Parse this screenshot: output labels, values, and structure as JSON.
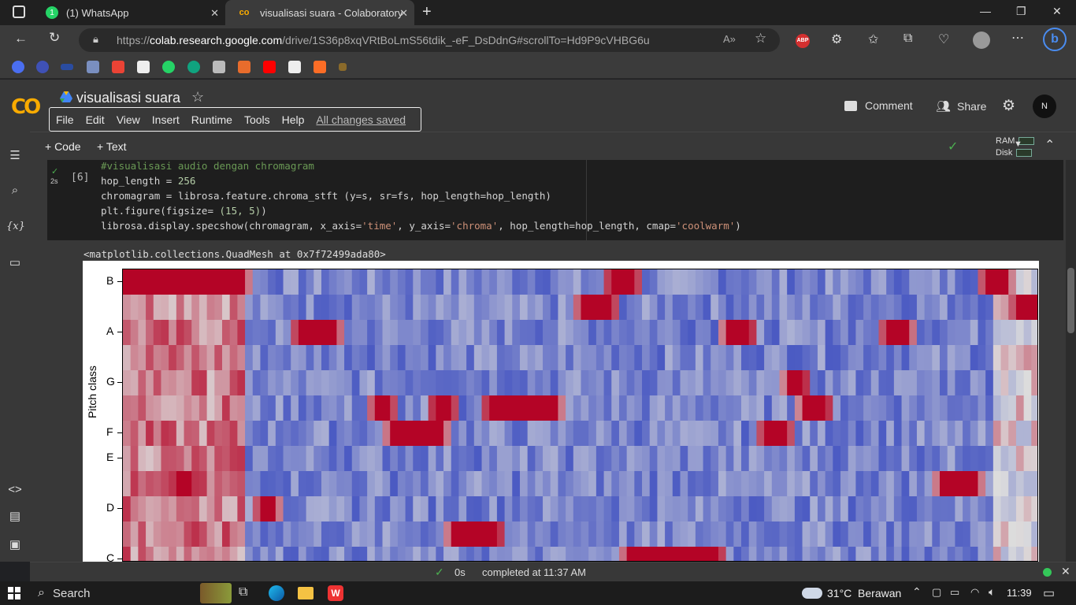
{
  "browser": {
    "tabs": [
      {
        "title": "(1) WhatsApp",
        "icon": "whatsapp-icon"
      },
      {
        "title": "visualisasi suara - Colaboratory",
        "icon": "colab-icon",
        "active": true
      }
    ],
    "url_prefix": "https://",
    "url_host": "colab.research.google.com",
    "url_path": "/drive/1S36p8xqVRtBoLmS56tdik_-eF_DsDdnG#scrollTo=Hd9P9cVHBG6u",
    "abp_label": "ABP"
  },
  "colab": {
    "logo": "CO",
    "title": "visualisasi suara",
    "menus": [
      "File",
      "Edit",
      "View",
      "Insert",
      "Runtime",
      "Tools",
      "Help"
    ],
    "saved_status": "All changes saved",
    "comment_label": "Comment",
    "share_label": "Share",
    "avatar_initials": "N",
    "toolbar": {
      "code_label": "+ Code",
      "text_label": "+ Text",
      "ram_label": "RAM",
      "disk_label": "Disk"
    }
  },
  "cell": {
    "exec_count": "[6]",
    "runtime": "2s",
    "code": {
      "line1": "#visualisasi audio dengan chromagram",
      "line2_a": "hop_length = ",
      "line2_b": "256",
      "line3": "chromagram = librosa.feature.chroma_stft (y=s, sr=fs, hop_length=hop_length)",
      "line4_a": "plt.figure(figsize= ",
      "line4_b": "(15, 5)",
      "line4_c": ")",
      "line5_a": "librosa.display.specshow(chromagram, x_axis=",
      "line5_b": "'time'",
      "line5_c": ", y_axis=",
      "line5_d": "'chroma'",
      "line5_e": ", hop_length=hop_length, cmap=",
      "line5_f": "'coolwarm'",
      "line5_g": ")"
    },
    "output_text": "<matplotlib.collections.QuadMesh at 0x7f72499ada80>"
  },
  "chart_data": {
    "type": "heatmap",
    "ylabel": "Pitch class",
    "y_ticks": [
      "B",
      "A",
      "G",
      "F",
      "E",
      "D",
      "C"
    ],
    "colormap": "coolwarm",
    "rows_top_to_bottom": [
      "B",
      "A#",
      "A",
      "G#",
      "G",
      "F#",
      "F",
      "E",
      "D#",
      "D",
      "C#",
      "C"
    ],
    "columns": 120,
    "hot_segments": [
      {
        "row": "B",
        "from": 0,
        "to": 16
      },
      {
        "row": "B",
        "from": 64,
        "to": 67
      },
      {
        "row": "B",
        "from": 113,
        "to": 116
      },
      {
        "row": "A#",
        "from": 60,
        "to": 64
      },
      {
        "row": "A#",
        "from": 117,
        "to": 120
      },
      {
        "row": "A",
        "from": 23,
        "to": 28
      },
      {
        "row": "A",
        "from": 79,
        "to": 82
      },
      {
        "row": "A",
        "from": 100,
        "to": 103
      },
      {
        "row": "G",
        "from": 87,
        "to": 89
      },
      {
        "row": "F#",
        "from": 33,
        "to": 35
      },
      {
        "row": "F#",
        "from": 41,
        "to": 43
      },
      {
        "row": "F#",
        "from": 48,
        "to": 57
      },
      {
        "row": "F#",
        "from": 89,
        "to": 92
      },
      {
        "row": "F",
        "from": 35,
        "to": 42
      },
      {
        "row": "F",
        "from": 84,
        "to": 87
      },
      {
        "row": "D#",
        "from": 7,
        "to": 9
      },
      {
        "row": "D#",
        "from": 107,
        "to": 112
      },
      {
        "row": "D",
        "from": 18,
        "to": 20
      },
      {
        "row": "C#",
        "from": 43,
        "to": 49
      },
      {
        "row": "C",
        "from": 66,
        "to": 78
      }
    ]
  },
  "status": {
    "time": "0s",
    "completed": "completed at 11:37 AM"
  },
  "taskbar": {
    "search_label": "Search",
    "weather": "31°C  Berawan",
    "clock": "11:39"
  }
}
